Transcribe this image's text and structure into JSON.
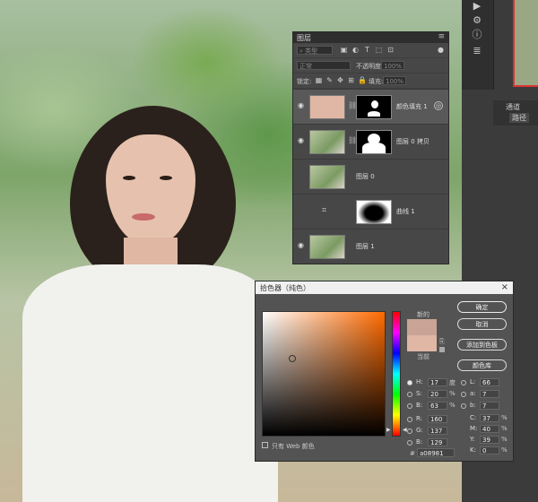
{
  "colors": {
    "selected_color": "#a08981",
    "current_color": "#e0b6a4",
    "accent": "#ff6a00"
  },
  "layers_panel": {
    "title": "图层",
    "search_placeholder": "类型",
    "blend_mode": "正常",
    "opacity_label": "不透明度:",
    "opacity_value": "100%",
    "lock_label": "锁定:",
    "fill_label": "填充:",
    "fill_value": "100%",
    "layers": [
      {
        "name": "颜色填充 1",
        "selected": true
      },
      {
        "name": "图层 0 拷贝"
      },
      {
        "name": "图层 0"
      },
      {
        "name": "曲线 1"
      },
      {
        "name": "图层 1"
      }
    ]
  },
  "right_panel": {
    "tabs": [
      "通道",
      "路径"
    ]
  },
  "color_picker": {
    "title": "拾色器（纯色）",
    "new_label": "新的",
    "current_label": "当前",
    "buttons": {
      "ok": "确定",
      "cancel": "取消",
      "add_swatch": "添加到色板",
      "libraries": "颜色库"
    },
    "web_only_label": "只有 Web 颜色",
    "fields": {
      "H": {
        "label": "H:",
        "value": "17",
        "unit": "度"
      },
      "S": {
        "label": "S:",
        "value": "20",
        "unit": "%"
      },
      "B": {
        "label": "B:",
        "value": "63",
        "unit": "%"
      },
      "R": {
        "label": "R:",
        "value": "160"
      },
      "G": {
        "label": "G:",
        "value": "137"
      },
      "Bv": {
        "label": "B:",
        "value": "129"
      },
      "L": {
        "label": "L:",
        "value": "66"
      },
      "a": {
        "label": "a:",
        "value": "7"
      },
      "b": {
        "label": "b:",
        "value": "7"
      },
      "C": {
        "label": "C:",
        "value": "37",
        "unit": "%"
      },
      "M": {
        "label": "M:",
        "value": "40",
        "unit": "%"
      },
      "Y": {
        "label": "Y:",
        "value": "39",
        "unit": "%"
      },
      "K": {
        "label": "K:",
        "value": "0",
        "unit": "%"
      }
    },
    "hex_label": "#",
    "hex_value": "a08981"
  }
}
